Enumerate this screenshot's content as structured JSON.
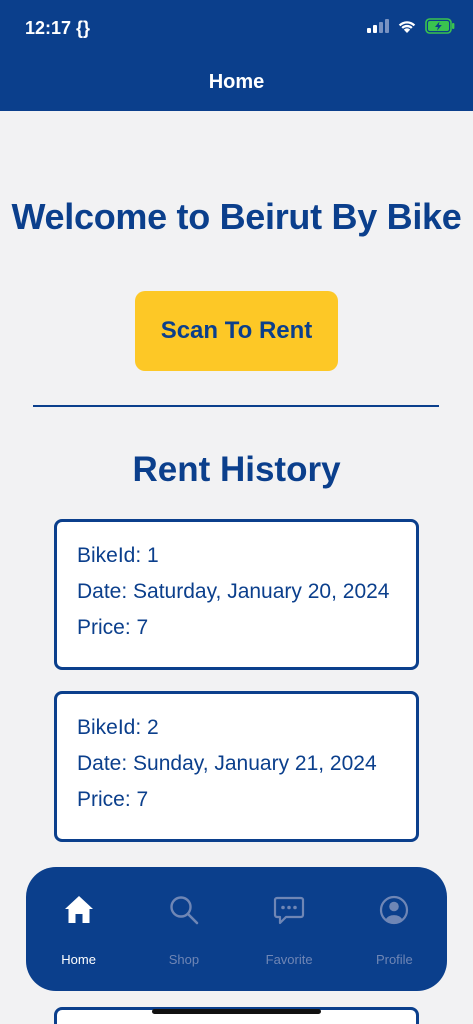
{
  "status_bar": {
    "time": "12:17 {}"
  },
  "header": {
    "title": "Home"
  },
  "welcome": "Welcome to Beirut By Bike",
  "scan_button": "Scan To Rent",
  "history": {
    "title": "Rent History",
    "items": [
      {
        "bike": "BikeId: 1",
        "date": "Date: Saturday, January 20, 2024",
        "price": "Price: 7"
      },
      {
        "bike": "BikeId: 2",
        "date": "Date: Sunday, January 21, 2024",
        "price": "Price: 7"
      }
    ]
  },
  "tabbar": {
    "tabs": [
      {
        "label": "Home",
        "icon": "home-icon",
        "active": true
      },
      {
        "label": "Shop",
        "icon": "search-icon",
        "active": false
      },
      {
        "label": "Favorite",
        "icon": "chat-icon",
        "active": false
      },
      {
        "label": "Profile",
        "icon": "user-icon",
        "active": false
      }
    ]
  },
  "colors": {
    "primary": "#0b3f8c",
    "accent": "#fdc826",
    "background": "#f2f2f3",
    "tab_inactive": "#6f86b5",
    "battery": "#3ac34f"
  }
}
